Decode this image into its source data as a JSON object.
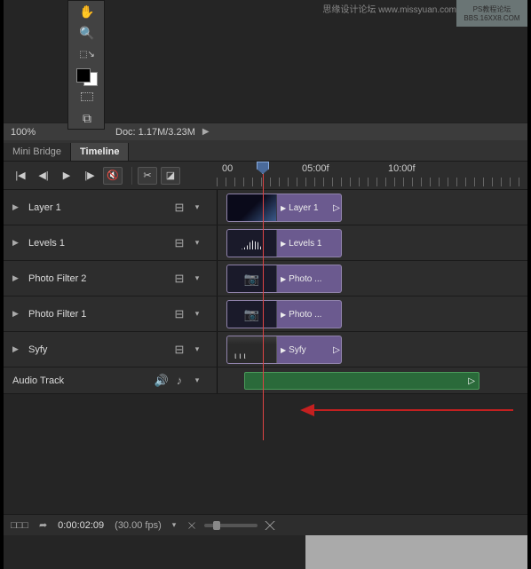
{
  "watermark": {
    "line1": "PS教程论坛",
    "line2": "BBS.16XX8.COM",
    "text2": "思缘设计论坛  www.missyuan.com"
  },
  "status": {
    "zoom": "100%",
    "doc": "Doc: 1.17M/3.23M"
  },
  "tabs": {
    "miniBridge": "Mini Bridge",
    "timeline": "Timeline"
  },
  "ruler": {
    "t0": "00",
    "t1": "05:00f",
    "t2": "10:00f"
  },
  "tracks": [
    {
      "name": "Layer 1",
      "clipLabel": "Layer 1"
    },
    {
      "name": "Levels 1",
      "clipLabel": "Levels 1"
    },
    {
      "name": "Photo Filter 2",
      "clipLabel": "Photo ..."
    },
    {
      "name": "Photo Filter 1",
      "clipLabel": "Photo ..."
    },
    {
      "name": "Syfy",
      "clipLabel": "Syfy"
    }
  ],
  "audioTrack": {
    "label": "Audio Track"
  },
  "bottomBar": {
    "frames": "□□□",
    "time": "0:00:02:09",
    "fps": "(30.00 fps)"
  }
}
